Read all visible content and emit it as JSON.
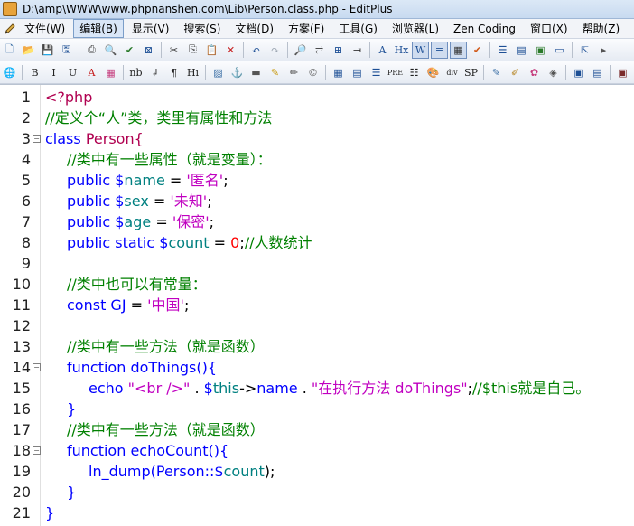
{
  "window": {
    "title": "D:\\amp\\WWW\\www.phpnanshen.com\\Lib\\Person.class.php - EditPlus"
  },
  "menu": [
    {
      "label": "文件(W)",
      "active": false
    },
    {
      "label": "编辑(B)",
      "active": true
    },
    {
      "label": "显示(V)",
      "active": false
    },
    {
      "label": "搜索(S)",
      "active": false
    },
    {
      "label": "文档(D)",
      "active": false
    },
    {
      "label": "方案(F)",
      "active": false
    },
    {
      "label": "工具(G)",
      "active": false
    },
    {
      "label": "浏览器(L)",
      "active": false
    },
    {
      "label": "Zen Coding",
      "active": false
    },
    {
      "label": "窗口(X)",
      "active": false
    },
    {
      "label": "帮助(Z)",
      "active": false
    }
  ],
  "toolbar1": [
    {
      "name": "new-file-icon",
      "glyph": "🗋",
      "color": "#3a6ea5"
    },
    {
      "name": "open-folder-icon",
      "glyph": "📂",
      "color": "#d59b2a"
    },
    {
      "name": "save-icon",
      "glyph": "💾",
      "color": "#2e5c9c"
    },
    {
      "name": "save-all-icon",
      "glyph": "🖫",
      "color": "#2e5c9c"
    },
    {
      "sep": true
    },
    {
      "name": "print-icon",
      "glyph": "⎙",
      "color": "#444"
    },
    {
      "name": "print-preview-icon",
      "glyph": "🔍",
      "color": "#444"
    },
    {
      "name": "spell-check-icon",
      "glyph": "✔",
      "color": "#2a7a2a"
    },
    {
      "name": "browser-preview-icon",
      "glyph": "⊠",
      "color": "#1d4f95"
    },
    {
      "sep": true
    },
    {
      "name": "cut-icon",
      "glyph": "✂",
      "color": "#333"
    },
    {
      "name": "copy-icon",
      "glyph": "⎘",
      "color": "#333"
    },
    {
      "name": "paste-icon",
      "glyph": "📋",
      "color": "#7a5a20"
    },
    {
      "name": "delete-icon",
      "glyph": "✕",
      "color": "#c62020"
    },
    {
      "sep": true
    },
    {
      "name": "undo-icon",
      "glyph": "↶",
      "color": "#1d4f95"
    },
    {
      "name": "redo-icon",
      "glyph": "↷",
      "color": "#9aa4b0"
    },
    {
      "sep": true
    },
    {
      "name": "find-icon",
      "glyph": "🔎",
      "color": "#333"
    },
    {
      "name": "replace-icon",
      "glyph": "⇄",
      "color": "#333"
    },
    {
      "name": "find-in-files-icon",
      "glyph": "⊞",
      "color": "#1d4f95"
    },
    {
      "name": "goto-line-icon",
      "glyph": "⇥",
      "color": "#333"
    },
    {
      "sep": true
    },
    {
      "name": "font-icon",
      "glyph": "A",
      "color": "#1d4f95"
    },
    {
      "name": "hex-icon",
      "glyph": "Hx",
      "color": "#1d4f95"
    },
    {
      "name": "word-wrap-icon",
      "glyph": "W",
      "color": "#1d4f95",
      "pressed": true
    },
    {
      "name": "line-number-icon",
      "glyph": "≡",
      "color": "#1d4f95",
      "pressed": true
    },
    {
      "name": "ruler-icon",
      "glyph": "▦",
      "color": "#333",
      "pressed": true
    },
    {
      "name": "check-icon",
      "glyph": "✔",
      "color": "#d15a1a"
    },
    {
      "sep": true
    },
    {
      "name": "window-list-icon",
      "glyph": "☰",
      "color": "#1d4f95"
    },
    {
      "name": "clip-text-icon",
      "glyph": "▤",
      "color": "#1d4f95"
    },
    {
      "name": "directory-icon",
      "glyph": "▣",
      "color": "#2a7a2a"
    },
    {
      "name": "output-window-icon",
      "glyph": "▭",
      "color": "#1d4f95"
    },
    {
      "sep": true
    },
    {
      "name": "help-icon",
      "glyph": "⇱",
      "color": "#1d4f95"
    },
    {
      "name": "toolbar-more-icon",
      "glyph": "▸",
      "color": "#555"
    }
  ],
  "toolbar2": [
    {
      "name": "globe-icon",
      "glyph": "🌐",
      "color": "#1d6fbf"
    },
    {
      "sep": true
    },
    {
      "name": "bold-icon",
      "glyph": "B",
      "color": "#222"
    },
    {
      "name": "italic-icon",
      "glyph": "I",
      "color": "#222"
    },
    {
      "name": "underline-icon",
      "glyph": "U",
      "color": "#222"
    },
    {
      "name": "font-color-icon",
      "glyph": "A",
      "color": "#c41a1a"
    },
    {
      "name": "color-palette-icon",
      "glyph": "▦",
      "color": "#c4387a"
    },
    {
      "sep": true
    },
    {
      "name": "nbsp-icon",
      "glyph": "nb",
      "color": "#222"
    },
    {
      "name": "line-break-icon",
      "glyph": "↲",
      "color": "#222"
    },
    {
      "name": "paragraph-icon",
      "glyph": "¶",
      "color": "#222"
    },
    {
      "name": "heading-icon",
      "glyph": "Hı",
      "color": "#222"
    },
    {
      "sep": true
    },
    {
      "name": "image-icon",
      "glyph": "▨",
      "color": "#3a6ea5"
    },
    {
      "name": "anchor-icon",
      "glyph": "⚓",
      "color": "#b07a10"
    },
    {
      "name": "hr-icon",
      "glyph": "▬",
      "color": "#555"
    },
    {
      "name": "marker-icon",
      "glyph": "✎",
      "color": "#c99a10"
    },
    {
      "name": "comment-icon",
      "glyph": "✏",
      "color": "#555"
    },
    {
      "name": "copyright-icon",
      "glyph": "©",
      "color": "#555"
    },
    {
      "sep": true
    },
    {
      "name": "table-icon",
      "glyph": "▦",
      "color": "#1d4f95"
    },
    {
      "name": "form-icon",
      "glyph": "▤",
      "color": "#1d4f95"
    },
    {
      "name": "align-center-icon",
      "glyph": "☰",
      "color": "#1d4f95"
    },
    {
      "name": "pre-icon",
      "glyph": "PRE",
      "color": "#222"
    },
    {
      "name": "list-icon",
      "glyph": "☷",
      "color": "#222"
    },
    {
      "name": "style-icon",
      "glyph": "🎨",
      "color": "#2a7a2a"
    },
    {
      "name": "div-icon",
      "glyph": "div",
      "color": "#222"
    },
    {
      "name": "span-icon",
      "glyph": "SP",
      "color": "#222"
    },
    {
      "sep": true
    },
    {
      "name": "edit-tag-icon",
      "glyph": "✎",
      "color": "#3a6ea5"
    },
    {
      "name": "script-icon",
      "glyph": "✐",
      "color": "#b07a10"
    },
    {
      "name": "plugin-icon",
      "glyph": "✿",
      "color": "#c4387a"
    },
    {
      "name": "html-toolbar-icon",
      "glyph": "◈",
      "color": "#555"
    },
    {
      "sep": true
    },
    {
      "name": "validate-icon",
      "glyph": "▣",
      "color": "#1d4f95"
    },
    {
      "name": "view-source-icon",
      "glyph": "▤",
      "color": "#1d4f95"
    },
    {
      "sep": true
    },
    {
      "name": "toolbar2-more-icon",
      "glyph": "▣",
      "color": "#7a2a2a"
    }
  ],
  "editor": {
    "lines": [
      {
        "n": "1",
        "fold": false,
        "indent": 0,
        "tokens": [
          {
            "t": "<?php",
            "k": "tag"
          }
        ]
      },
      {
        "n": "2",
        "fold": false,
        "indent": 0,
        "tokens": [
          {
            "t": "//定义个“人”类，类里有属性和方法",
            "k": "comment"
          }
        ]
      },
      {
        "n": "3",
        "fold": true,
        "indent": 0,
        "tokens": [
          {
            "t": "class",
            "k": "keyword"
          },
          {
            "t": " ",
            "k": "plain"
          },
          {
            "t": "Person{",
            "k": "class"
          }
        ]
      },
      {
        "n": "4",
        "fold": false,
        "indent": 1,
        "tokens": [
          {
            "t": "//类中有一些属性（就是变量）：",
            "k": "comment"
          }
        ]
      },
      {
        "n": "5",
        "fold": false,
        "indent": 1,
        "tokens": [
          {
            "t": "public ",
            "k": "keyword"
          },
          {
            "t": "$",
            "k": "keyword"
          },
          {
            "t": "name",
            "k": "var"
          },
          {
            "t": " = ",
            "k": "plain"
          },
          {
            "t": "'匿名'",
            "k": "string"
          },
          {
            "t": ";",
            "k": "plain"
          }
        ]
      },
      {
        "n": "6",
        "fold": false,
        "indent": 1,
        "tokens": [
          {
            "t": "public ",
            "k": "keyword"
          },
          {
            "t": "$",
            "k": "keyword"
          },
          {
            "t": "sex",
            "k": "var"
          },
          {
            "t": " = ",
            "k": "plain"
          },
          {
            "t": "'未知'",
            "k": "string"
          },
          {
            "t": ";",
            "k": "plain"
          }
        ]
      },
      {
        "n": "7",
        "fold": false,
        "indent": 1,
        "tokens": [
          {
            "t": "public ",
            "k": "keyword"
          },
          {
            "t": "$",
            "k": "keyword"
          },
          {
            "t": "age",
            "k": "var"
          },
          {
            "t": " = ",
            "k": "plain"
          },
          {
            "t": "'保密'",
            "k": "string"
          },
          {
            "t": ";",
            "k": "plain"
          }
        ]
      },
      {
        "n": "8",
        "fold": false,
        "indent": 1,
        "tokens": [
          {
            "t": "public static ",
            "k": "keyword"
          },
          {
            "t": "$",
            "k": "keyword"
          },
          {
            "t": "count",
            "k": "var"
          },
          {
            "t": " = ",
            "k": "plain"
          },
          {
            "t": "0",
            "k": "number"
          },
          {
            "t": ";",
            "k": "plain"
          },
          {
            "t": "//人数统计",
            "k": "comment"
          }
        ]
      },
      {
        "n": "9",
        "fold": false,
        "indent": 0,
        "tokens": []
      },
      {
        "n": "10",
        "fold": false,
        "indent": 1,
        "tokens": [
          {
            "t": "//类中也可以有常量：",
            "k": "comment"
          }
        ]
      },
      {
        "n": "11",
        "fold": false,
        "indent": 1,
        "tokens": [
          {
            "t": "const ",
            "k": "keyword"
          },
          {
            "t": "GJ",
            "k": "keyword"
          },
          {
            "t": " = ",
            "k": "plain"
          },
          {
            "t": "'中国'",
            "k": "string"
          },
          {
            "t": ";",
            "k": "plain"
          }
        ]
      },
      {
        "n": "12",
        "fold": false,
        "indent": 0,
        "tokens": []
      },
      {
        "n": "13",
        "fold": false,
        "indent": 1,
        "tokens": [
          {
            "t": "//类中有一些方法（就是函数）",
            "k": "comment"
          }
        ]
      },
      {
        "n": "14",
        "fold": true,
        "indent": 1,
        "tokens": [
          {
            "t": "function ",
            "k": "keyword"
          },
          {
            "t": "doThings(){",
            "k": "keyword"
          }
        ]
      },
      {
        "n": "15",
        "fold": false,
        "indent": 2,
        "tokens": [
          {
            "t": "echo ",
            "k": "keyword"
          },
          {
            "t": "\"<br />\"",
            "k": "string"
          },
          {
            "t": " . ",
            "k": "plain"
          },
          {
            "t": "$",
            "k": "keyword"
          },
          {
            "t": "this",
            "k": "var"
          },
          {
            "t": "->",
            "k": "plain"
          },
          {
            "t": "name",
            "k": "keyword"
          },
          {
            "t": " . ",
            "k": "plain"
          },
          {
            "t": "\"在执行方法 doThings\"",
            "k": "string"
          },
          {
            "t": ";",
            "k": "plain"
          },
          {
            "t": "//$this就是自己。",
            "k": "comment"
          }
        ]
      },
      {
        "n": "16",
        "fold": false,
        "indent": 1,
        "tokens": [
          {
            "t": "}",
            "k": "keyword"
          }
        ]
      },
      {
        "n": "17",
        "fold": false,
        "indent": 1,
        "tokens": [
          {
            "t": "//类中有一些方法（就是函数）",
            "k": "comment"
          }
        ]
      },
      {
        "n": "18",
        "fold": true,
        "indent": 1,
        "tokens": [
          {
            "t": "function ",
            "k": "keyword"
          },
          {
            "t": "echoCount(){",
            "k": "keyword"
          }
        ]
      },
      {
        "n": "19",
        "fold": false,
        "indent": 2,
        "tokens": [
          {
            "t": "ln_dump(",
            "k": "keyword"
          },
          {
            "t": "Person::",
            "k": "keyword"
          },
          {
            "t": "$",
            "k": "keyword"
          },
          {
            "t": "count",
            "k": "var"
          },
          {
            "t": ");",
            "k": "plain"
          }
        ]
      },
      {
        "n": "20",
        "fold": false,
        "indent": 1,
        "tokens": [
          {
            "t": "}",
            "k": "keyword"
          }
        ]
      },
      {
        "n": "21",
        "fold": false,
        "indent": 0,
        "tokens": [
          {
            "t": "}",
            "k": "keyword"
          }
        ]
      }
    ]
  }
}
